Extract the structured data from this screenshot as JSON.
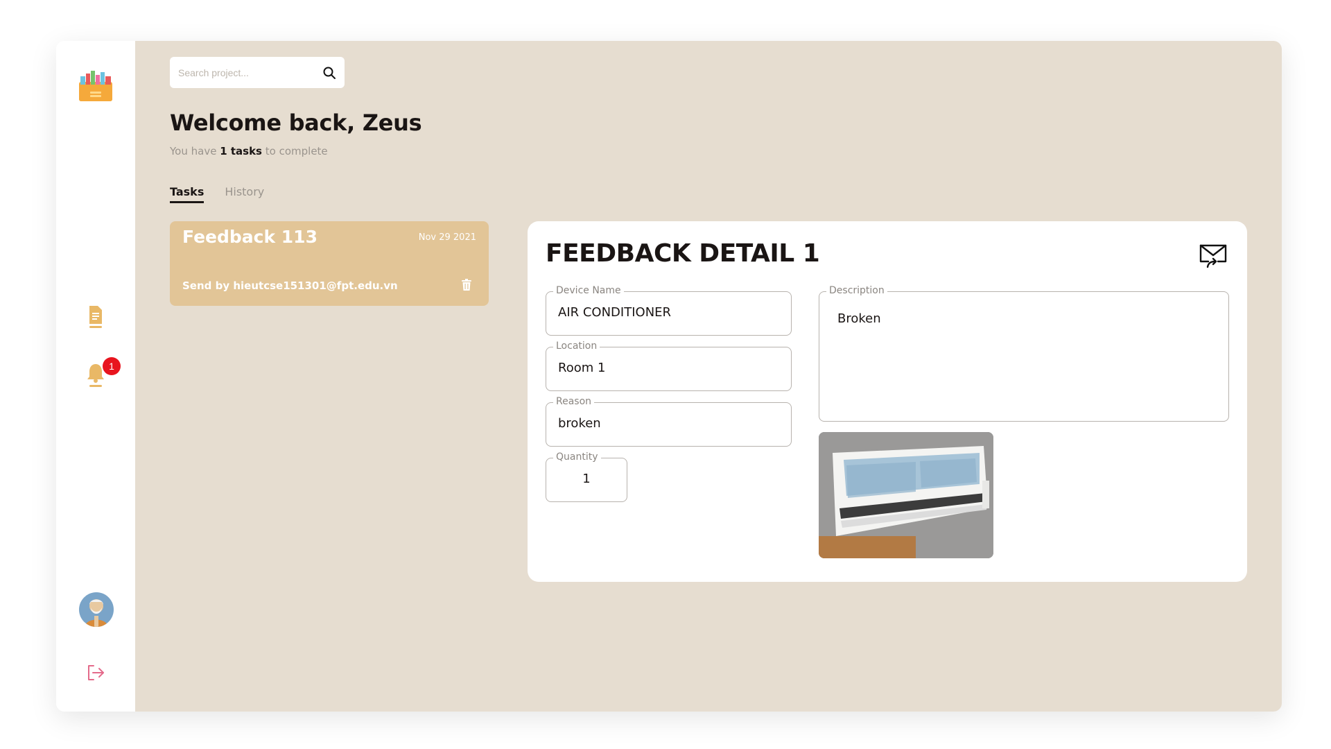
{
  "sidebar": {
    "logo": "toolbox-logo",
    "items": [
      {
        "icon": "document-icon",
        "label": ""
      },
      {
        "icon": "bell-icon",
        "badge": "1"
      }
    ],
    "avatar": "user-avatar",
    "logout_icon": "logout-icon"
  },
  "search": {
    "placeholder": "Search project..."
  },
  "header": {
    "welcome": "Welcome back, Zeus",
    "subtitle_prefix": "You have ",
    "subtitle_count": "1 tasks",
    "subtitle_suffix": " to complete"
  },
  "tabs": [
    {
      "label": "Tasks",
      "active": true
    },
    {
      "label": "History",
      "active": false
    }
  ],
  "task_card": {
    "title": "Feedback 113",
    "date": "Nov 29 2021",
    "sender": "Send by hieutcse151301@fpt.edu.vn"
  },
  "detail": {
    "title": "FEEDBACK DETAIL 1",
    "device_name_label": "Device Name",
    "device_name": "AIR CONDITIONER",
    "location_label": "Location",
    "location": "Room 1",
    "reason_label": "Reason",
    "reason": "broken",
    "quantity_label": "Quantity",
    "quantity": "1",
    "description_label": "Description",
    "description": "Broken"
  },
  "colors": {
    "main_bg": "#e6ddd0",
    "card_bg": "#e2c597",
    "accent_icon": "#e9b866",
    "badge": "#e8141e",
    "logout": "#e46a8a"
  }
}
